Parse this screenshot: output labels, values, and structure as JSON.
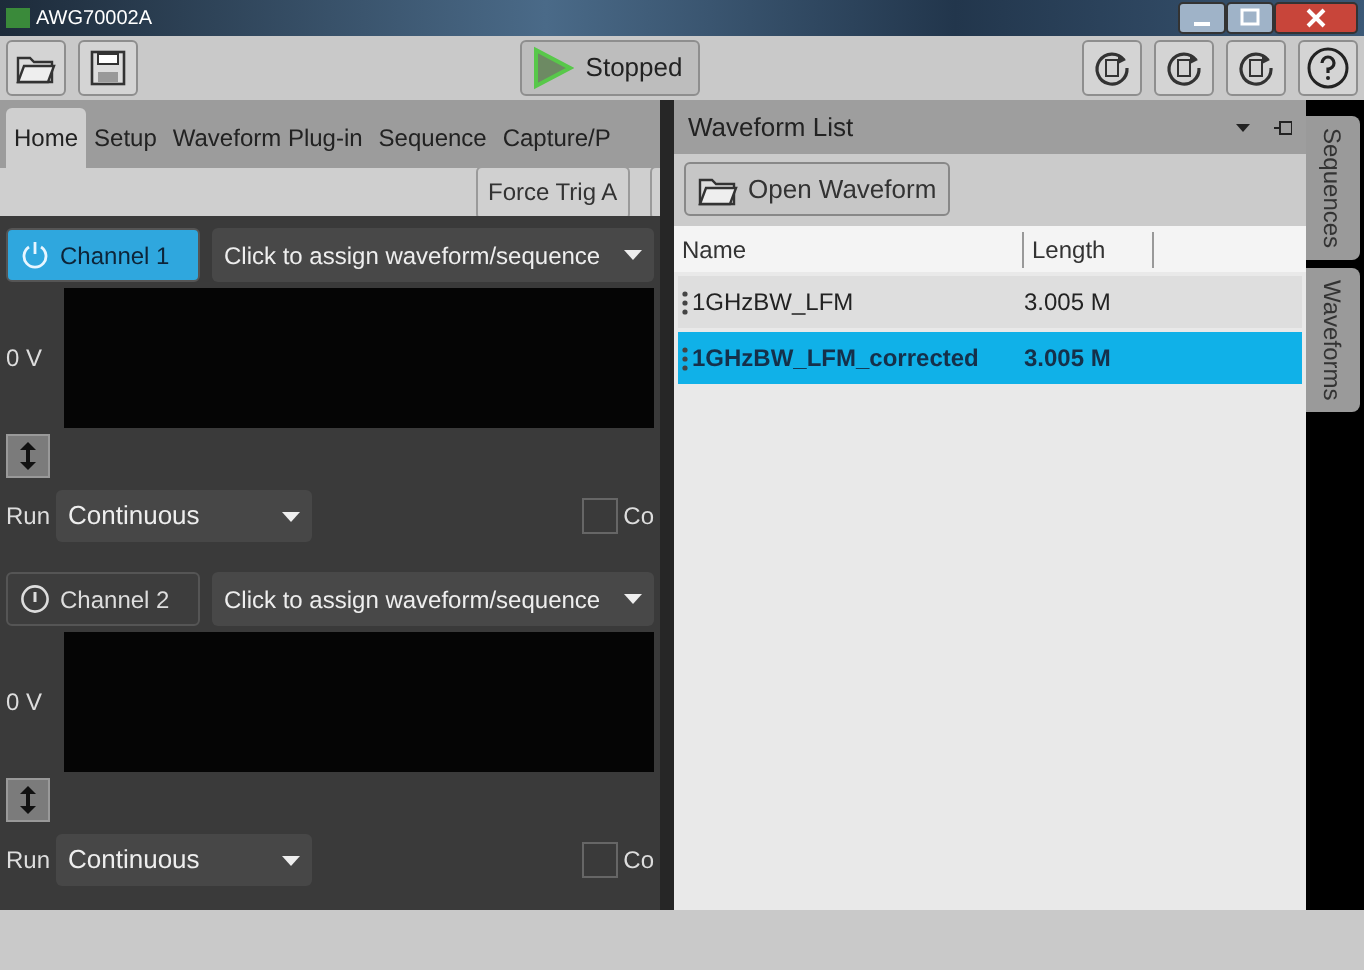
{
  "window": {
    "title": "AWG70002A"
  },
  "toolbar": {
    "run_label": "Stopped"
  },
  "tabs": [
    {
      "label": "Home",
      "selected": true
    },
    {
      "label": "Setup",
      "selected": false
    },
    {
      "label": "Waveform Plug-in",
      "selected": false
    },
    {
      "label": "Sequence",
      "selected": false
    },
    {
      "label": "Capture/P",
      "selected": false
    }
  ],
  "force_trig_button": "Force Trig A",
  "channels": [
    {
      "label": "Channel 1",
      "on": true,
      "assign": "Click to assign waveform/sequence",
      "voltage": "0 V",
      "run_label": "Run",
      "run_mode": "Continuous",
      "checked": false,
      "check_label": "Co"
    },
    {
      "label": "Channel 2",
      "on": false,
      "assign": "Click to assign waveform/sequence",
      "voltage": "0 V",
      "run_label": "Run",
      "run_mode": "Continuous",
      "checked": false,
      "check_label": "Co"
    }
  ],
  "waveform_list": {
    "title": "Waveform List",
    "open_button": "Open Waveform",
    "columns": [
      "Name",
      "Length"
    ],
    "rows": [
      {
        "name": "1GHzBW_LFM",
        "length": "3.005 M",
        "selected": false
      },
      {
        "name": "1GHzBW_LFM_corrected",
        "length": "3.005 M",
        "selected": true
      }
    ]
  },
  "side_tabs": [
    "Sequences",
    "Waveforms"
  ]
}
